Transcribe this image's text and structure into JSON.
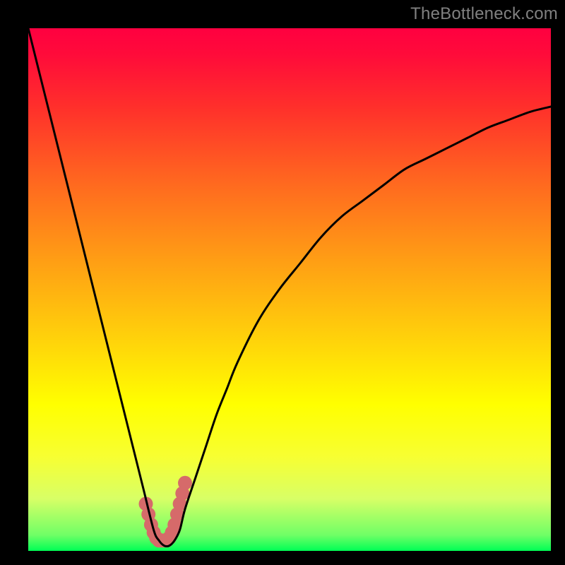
{
  "watermark": "TheBottleneck.com",
  "chart_data": {
    "type": "line",
    "title": "",
    "xlabel": "",
    "ylabel": "",
    "xlim": [
      0,
      100
    ],
    "ylim": [
      0,
      100
    ],
    "x": [
      0,
      2,
      4,
      6,
      8,
      10,
      12,
      14,
      16,
      18,
      20,
      22,
      24,
      25,
      26,
      27,
      28,
      29,
      30,
      32,
      34,
      36,
      38,
      40,
      44,
      48,
      52,
      56,
      60,
      64,
      68,
      72,
      76,
      80,
      84,
      88,
      92,
      96,
      100
    ],
    "values": [
      100,
      92,
      84,
      76,
      68,
      60,
      52,
      44,
      36,
      28,
      20,
      12,
      4,
      2,
      1,
      1,
      2,
      4,
      8,
      14,
      20,
      26,
      31,
      36,
      44,
      50,
      55,
      60,
      64,
      67,
      70,
      73,
      75,
      77,
      79,
      81,
      82.5,
      84,
      85
    ],
    "dots": {
      "x": [
        22.5,
        23.0,
        23.5,
        24.0,
        24.5,
        25.0,
        25.5,
        26.0,
        26.5,
        27.0,
        27.5,
        28.0,
        28.5,
        29.0,
        29.5,
        30.0
      ],
      "values": [
        9.0,
        7.0,
        5.0,
        3.5,
        2.5,
        2.0,
        2.0,
        2.0,
        2.0,
        2.5,
        3.5,
        5.0,
        7.0,
        9.0,
        11.0,
        13.0
      ]
    },
    "gradient_stops": [
      {
        "offset": 0.0,
        "color": "#ff0040"
      },
      {
        "offset": 0.05,
        "color": "#ff0b3a"
      },
      {
        "offset": 0.15,
        "color": "#ff2f2b"
      },
      {
        "offset": 0.3,
        "color": "#ff6a1f"
      },
      {
        "offset": 0.45,
        "color": "#ffa014"
      },
      {
        "offset": 0.6,
        "color": "#ffd40a"
      },
      {
        "offset": 0.72,
        "color": "#ffff00"
      },
      {
        "offset": 0.82,
        "color": "#f7ff32"
      },
      {
        "offset": 0.9,
        "color": "#d8ff66"
      },
      {
        "offset": 0.97,
        "color": "#6fff66"
      },
      {
        "offset": 1.0,
        "color": "#00ff55"
      }
    ]
  }
}
